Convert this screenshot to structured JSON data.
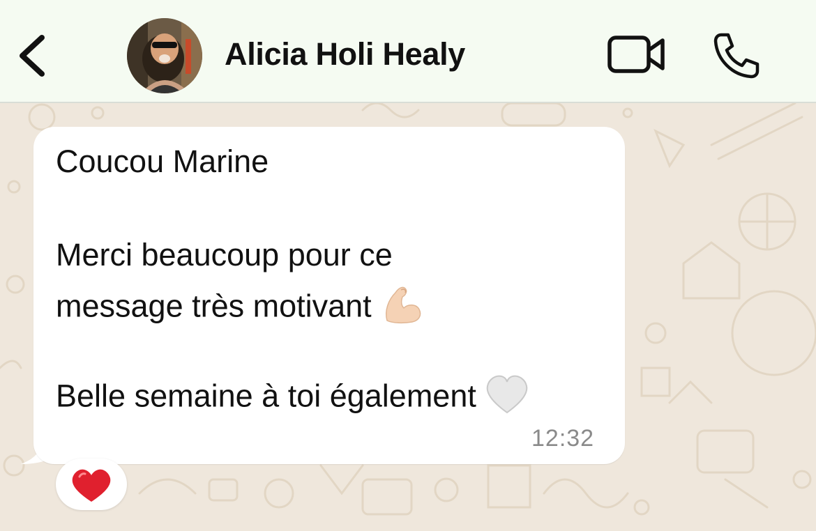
{
  "header": {
    "back_icon": "chevron-left-icon",
    "contact_name": "Alicia Holi Healy",
    "video_icon": "video-camera-icon",
    "call_icon": "phone-icon"
  },
  "message": {
    "greeting": "Coucou Marine",
    "line1": "Merci beaucoup pour ce",
    "line2": "message très motivant",
    "line2_emoji": "flexed-biceps-emoji",
    "line3": "Belle semaine à toi également",
    "line3_emoji": "white-heart-emoji",
    "time": "12:32",
    "reaction": "red-heart-emoji"
  },
  "colors": {
    "header_bg": "#f5fbf2",
    "wallpaper_bg": "#efe7dc",
    "bubble_bg": "#ffffff",
    "reaction_heart": "#e0202e"
  }
}
